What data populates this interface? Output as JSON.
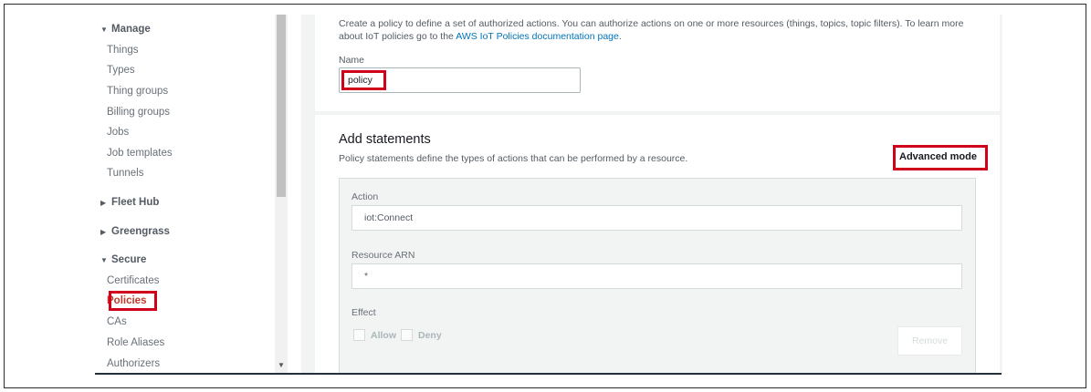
{
  "sidebar": {
    "sections": [
      {
        "label": "Manage",
        "expanded": true,
        "items": [
          "Things",
          "Types",
          "Thing groups",
          "Billing groups",
          "Jobs",
          "Job templates",
          "Tunnels"
        ]
      },
      {
        "label": "Fleet Hub",
        "expanded": false
      },
      {
        "label": "Greengrass",
        "expanded": false
      },
      {
        "label": "Secure",
        "expanded": true,
        "items": [
          "Certificates",
          "Policies",
          "CAs",
          "Role Aliases",
          "Authorizers"
        ]
      }
    ],
    "active_item": "Policies"
  },
  "intro": {
    "text": "Create a policy to define a set of authorized actions. You can authorize actions on one or more resources (things, topics, topic filters). To learn more about IoT policies go to the ",
    "link": "AWS IoT Policies documentation page",
    "suffix": "."
  },
  "name_field": {
    "label": "Name",
    "value": "policy"
  },
  "statements": {
    "title": "Add statements",
    "description": "Policy statements define the types of actions that can be performed by a resource.",
    "advanced_mode": "Advanced mode",
    "action_label": "Action",
    "action_value": "iot:Connect",
    "resource_label": "Resource ARN",
    "resource_value": "*",
    "effect_label": "Effect",
    "allow_label": "Allow",
    "deny_label": "Deny",
    "remove_label": "Remove"
  },
  "colors": {
    "highlight": "#d0021b",
    "link": "#0073bb"
  }
}
